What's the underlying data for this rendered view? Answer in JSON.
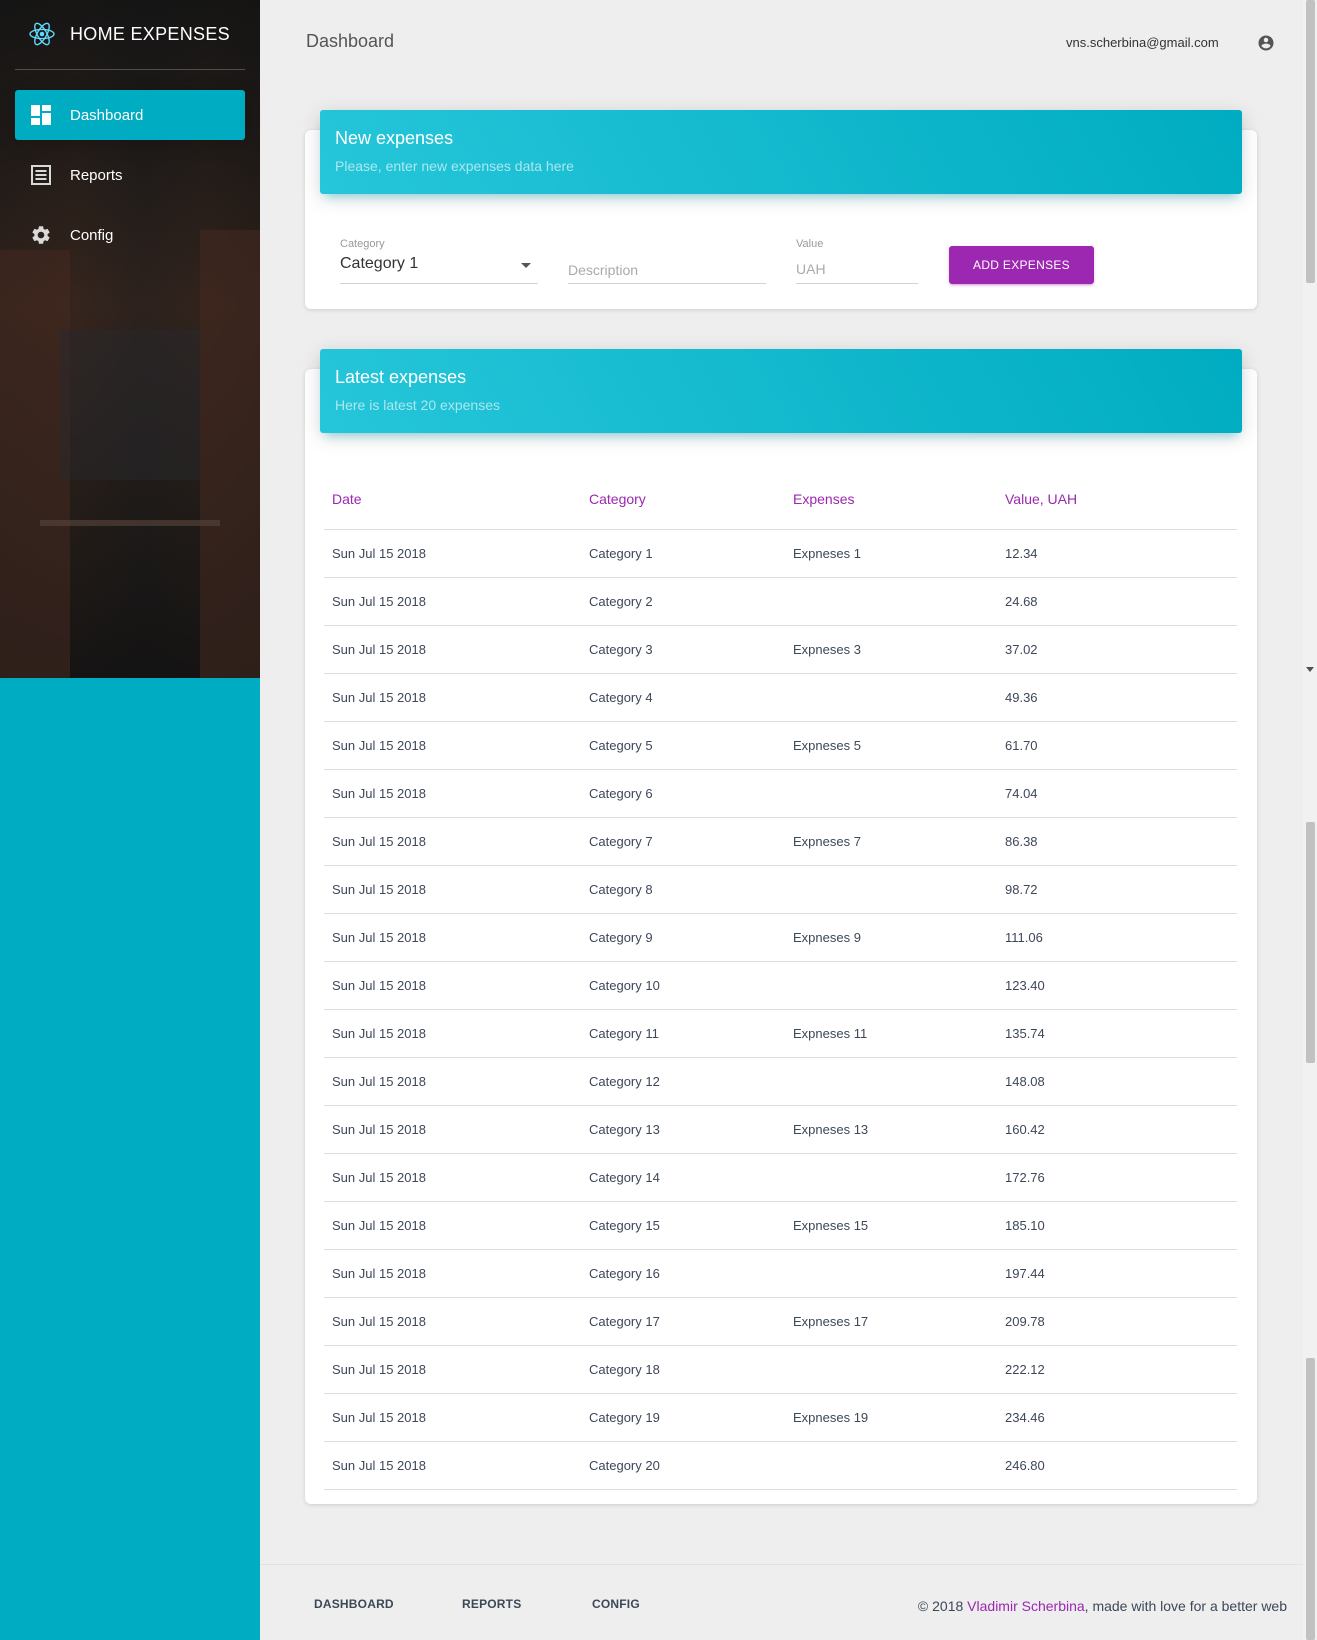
{
  "app": {
    "title": "HOME EXPENSES",
    "logo_icon": "react-atom-icon"
  },
  "sidebar": {
    "items": [
      {
        "label": "Dashboard",
        "icon": "dashboard-icon",
        "active": true
      },
      {
        "label": "Reports",
        "icon": "reports-icon",
        "active": false
      },
      {
        "label": "Config",
        "icon": "gear-icon",
        "active": false
      }
    ]
  },
  "header": {
    "title": "Dashboard",
    "user_email": "vns.scherbina@gmail.com",
    "user_icon": "account-circle-icon"
  },
  "new_expenses": {
    "title": "New expenses",
    "subtitle": "Please, enter new expenses data here",
    "category_label": "Category",
    "category_value": "Category 1",
    "description_placeholder": "Description",
    "value_label": "Value",
    "value_placeholder": "UAH",
    "submit_label": "ADD EXPENSES"
  },
  "latest_expenses": {
    "title": "Latest expenses",
    "subtitle": "Here is latest 20 expenses",
    "columns": [
      "Date",
      "Category",
      "Expenses",
      "Value, UAH"
    ],
    "rows": [
      [
        "Sun Jul 15 2018",
        "Category 1",
        "Expneses 1",
        "12.34"
      ],
      [
        "Sun Jul 15 2018",
        "Category 2",
        "",
        "24.68"
      ],
      [
        "Sun Jul 15 2018",
        "Category 3",
        "Expneses 3",
        "37.02"
      ],
      [
        "Sun Jul 15 2018",
        "Category 4",
        "",
        "49.36"
      ],
      [
        "Sun Jul 15 2018",
        "Category 5",
        "Expneses 5",
        "61.70"
      ],
      [
        "Sun Jul 15 2018",
        "Category 6",
        "",
        "74.04"
      ],
      [
        "Sun Jul 15 2018",
        "Category 7",
        "Expneses 7",
        "86.38"
      ],
      [
        "Sun Jul 15 2018",
        "Category 8",
        "",
        "98.72"
      ],
      [
        "Sun Jul 15 2018",
        "Category 9",
        "Expneses 9",
        "111.06"
      ],
      [
        "Sun Jul 15 2018",
        "Category 10",
        "",
        "123.40"
      ],
      [
        "Sun Jul 15 2018",
        "Category 11",
        "Expneses 11",
        "135.74"
      ],
      [
        "Sun Jul 15 2018",
        "Category 12",
        "",
        "148.08"
      ],
      [
        "Sun Jul 15 2018",
        "Category 13",
        "Expneses 13",
        "160.42"
      ],
      [
        "Sun Jul 15 2018",
        "Category 14",
        "",
        "172.76"
      ],
      [
        "Sun Jul 15 2018",
        "Category 15",
        "Expneses 15",
        "185.10"
      ],
      [
        "Sun Jul 15 2018",
        "Category 16",
        "",
        "197.44"
      ],
      [
        "Sun Jul 15 2018",
        "Category 17",
        "Expneses 17",
        "209.78"
      ],
      [
        "Sun Jul 15 2018",
        "Category 18",
        "",
        "222.12"
      ],
      [
        "Sun Jul 15 2018",
        "Category 19",
        "Expneses 19",
        "234.46"
      ],
      [
        "Sun Jul 15 2018",
        "Category 20",
        "",
        "246.80"
      ]
    ]
  },
  "footer": {
    "links": [
      "DASHBOARD",
      "REPORTS",
      "CONFIG"
    ],
    "copyright_prefix": "© 2018 ",
    "copyright_author": "Vladimir Scherbina",
    "copyright_suffix": ", made with love for a better web"
  },
  "colors": {
    "accent": "#00acc1",
    "primary": "#9c27b0"
  }
}
